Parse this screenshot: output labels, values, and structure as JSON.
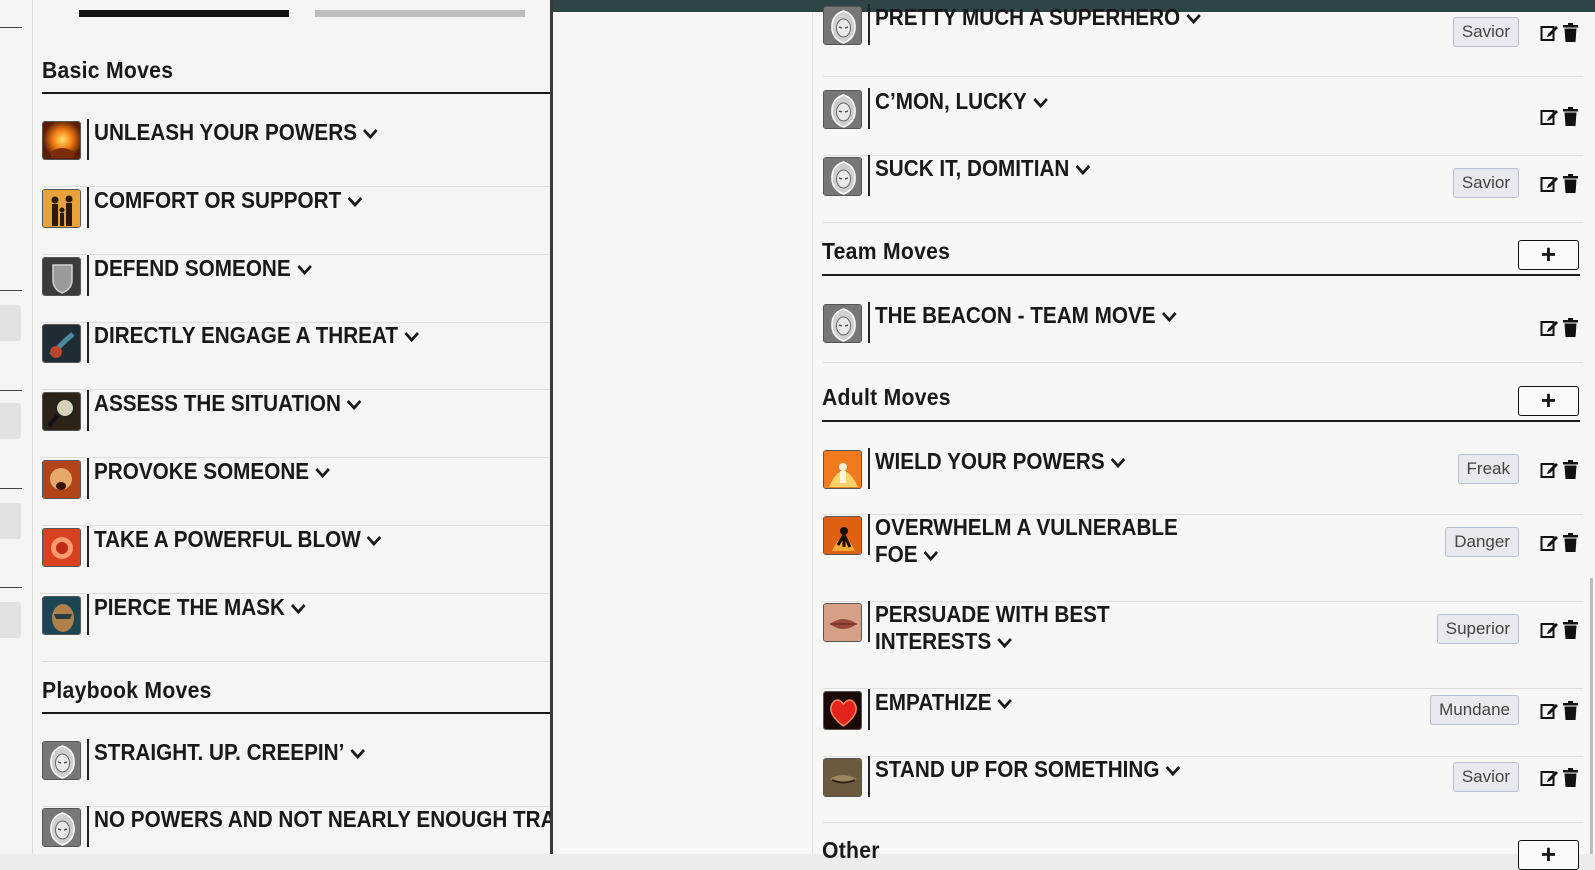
{
  "left_panel": {
    "basic_moves_title": "Basic Moves",
    "basic_moves": [
      {
        "name": "UNLEASH YOUR POWERS",
        "icon": "flame-hand-icon"
      },
      {
        "name": "COMFORT OR SUPPORT",
        "icon": "family-silhouette-icon"
      },
      {
        "name": "DEFEND SOMEONE",
        "icon": "shield-icon"
      },
      {
        "name": "DIRECTLY ENGAGE A THREAT",
        "icon": "grappling-fist-icon"
      },
      {
        "name": "ASSESS THE SITUATION",
        "icon": "magnifier-icon"
      },
      {
        "name": "PROVOKE SOMEONE",
        "icon": "shouting-face-icon"
      },
      {
        "name": "TAKE A POWERFUL BLOW",
        "icon": "punch-icon"
      },
      {
        "name": "PIERCE THE MASK",
        "icon": "masked-face-icon"
      }
    ],
    "playbook_moves_title": "Playbook Moves",
    "playbook_moves": [
      {
        "name": "STRAIGHT. UP. CREEPIN’",
        "icon": "hooded-figure-icon"
      },
      {
        "name": "NO POWERS AND NOT NEARLY ENOUGH TRA",
        "icon": "hooded-figure-icon"
      }
    ]
  },
  "right_panel": {
    "playbook_moves_cont": [
      {
        "name": "PRETTY MUCH A SUPERHERO",
        "tag": "Savior",
        "icon": "hooded-figure-icon"
      },
      {
        "name": "C’MON, LUCKY",
        "tag": "",
        "icon": "hooded-figure-icon"
      },
      {
        "name": "SUCK IT, DOMITIAN",
        "tag": "Savior",
        "icon": "hooded-figure-icon"
      }
    ],
    "team_moves_title": "Team Moves",
    "team_moves": [
      {
        "name": "THE BEACON - TEAM MOVE",
        "tag": "",
        "icon": "hooded-figure-icon"
      }
    ],
    "adult_moves_title": "Adult Moves",
    "adult_moves": [
      {
        "name_line1": "WIELD YOUR POWERS",
        "name_line2": "",
        "tag": "Freak",
        "icon": "fire-figure-icon"
      },
      {
        "name_line1": "OVERWHELM A VULNERABLE",
        "name_line2": "FOE",
        "tag": "Danger",
        "icon": "burning-man-icon"
      },
      {
        "name_line1": "PERSUADE WITH BEST",
        "name_line2": "INTERESTS",
        "tag": "Superior",
        "icon": "lips-icon"
      },
      {
        "name_line1": "EMPATHIZE",
        "name_line2": "",
        "tag": "Mundane",
        "icon": "heart-icon"
      },
      {
        "name_line1": "STAND UP FOR SOMETHING",
        "name_line2": "",
        "tag": "Savior",
        "icon": "closed-eye-icon"
      }
    ],
    "other_title": "Other",
    "add_label": "+"
  },
  "colors": {
    "top_strip": "#2f4446",
    "tag_bg": "#e8eaf0",
    "tag_border": "#b8bfd3",
    "text": "#191919"
  }
}
